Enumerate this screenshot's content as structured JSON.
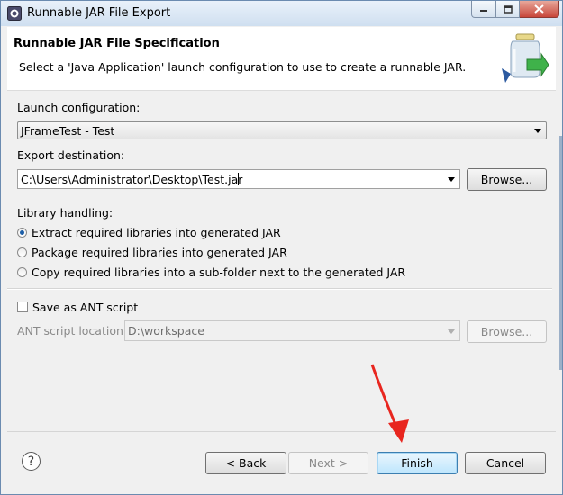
{
  "window": {
    "title": "Runnable JAR File Export",
    "icons": {
      "app": "eclipse-icon",
      "minimize": "minimize-icon",
      "maximize": "maximize-icon",
      "close": "close-icon"
    }
  },
  "header": {
    "title": "Runnable JAR File Specification",
    "description": "Select a 'Java Application' launch configuration to use to create a runnable JAR.",
    "icon": "jar-export-icon"
  },
  "launch": {
    "label": "Launch configuration:",
    "value": "JFrameTest - Test"
  },
  "destination": {
    "label": "Export destination:",
    "value": "C:\\Users\\Administrator\\Desktop\\Test.jar",
    "browse_label": "Browse..."
  },
  "library": {
    "label": "Library handling:",
    "options": [
      {
        "label": "Extract required libraries into generated JAR",
        "selected": true
      },
      {
        "label": "Package required libraries into generated JAR",
        "selected": false
      },
      {
        "label": "Copy required libraries into a sub-folder next to the generated JAR",
        "selected": false
      }
    ]
  },
  "ant": {
    "checkbox_label": "Save as ANT script",
    "checked": false,
    "location_label": "ANT script location:",
    "location_value": "D:\\workspace",
    "browse_label": "Browse..."
  },
  "footer": {
    "help_icon": "help-icon",
    "help_glyph": "?",
    "back_label": "< Back",
    "next_label": "Next >",
    "finish_label": "Finish",
    "cancel_label": "Cancel"
  },
  "colors": {
    "annotation_arrow": "#e8261f",
    "accent": "#1d5fa8"
  }
}
